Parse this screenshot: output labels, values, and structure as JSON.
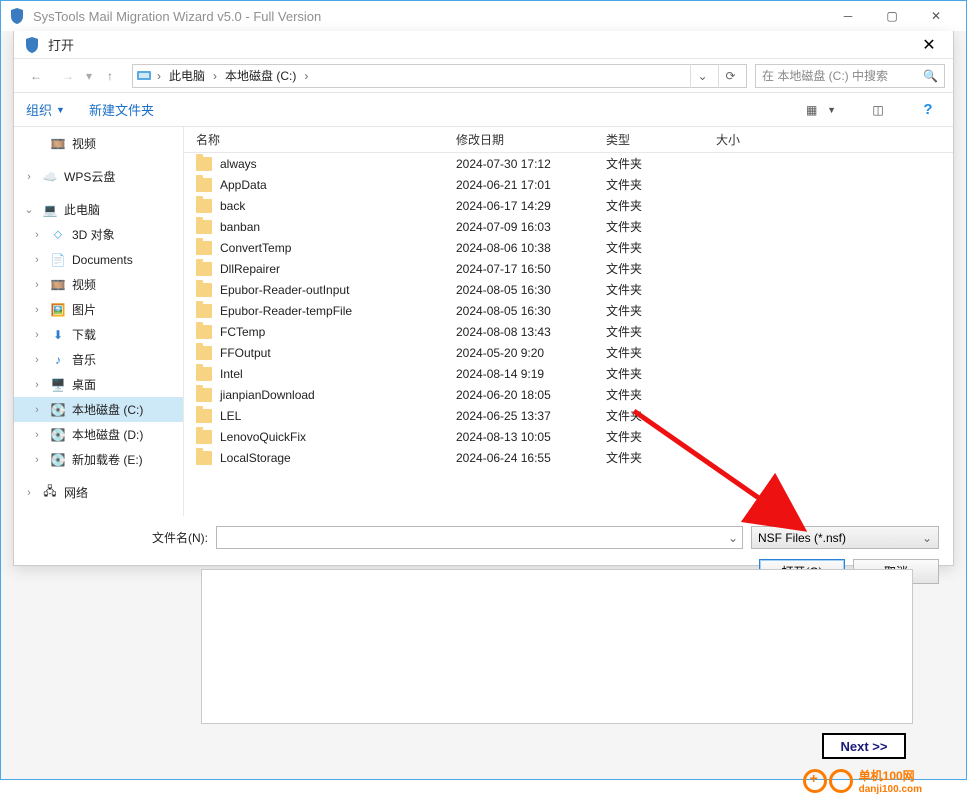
{
  "outerWindow": {
    "title": "SysTools Mail Migration Wizard v5.0 - Full Version"
  },
  "dialog": {
    "title": "打开",
    "breadcrumb": {
      "root": "此电脑",
      "drive": "本地磁盘 (C:)"
    },
    "searchPlaceholder": "在 本地磁盘 (C:) 中搜索",
    "toolbar": {
      "organize": "组织",
      "newFolder": "新建文件夹"
    },
    "columns": {
      "name": "名称",
      "date": "修改日期",
      "type": "类型",
      "size": "大小"
    },
    "sidebar": {
      "videos": "视频",
      "wps": "WPS云盘",
      "thisPC": "此电脑",
      "objects3d": "3D 对象",
      "documents": "Documents",
      "videos2": "视频",
      "pictures": "图片",
      "downloads": "下载",
      "music": "音乐",
      "desktop": "桌面",
      "driveC": "本地磁盘 (C:)",
      "driveD": "本地磁盘 (D:)",
      "driveE": "新加载卷 (E:)",
      "network": "网络"
    },
    "files": [
      {
        "name": "always",
        "date": "2024-07-30 17:12",
        "type": "文件夹"
      },
      {
        "name": "AppData",
        "date": "2024-06-21 17:01",
        "type": "文件夹"
      },
      {
        "name": "back",
        "date": "2024-06-17 14:29",
        "type": "文件夹"
      },
      {
        "name": "banban",
        "date": "2024-07-09 16:03",
        "type": "文件夹"
      },
      {
        "name": "ConvertTemp",
        "date": "2024-08-06 10:38",
        "type": "文件夹"
      },
      {
        "name": "DllRepairer",
        "date": "2024-07-17 16:50",
        "type": "文件夹"
      },
      {
        "name": "Epubor-Reader-outInput",
        "date": "2024-08-05 16:30",
        "type": "文件夹"
      },
      {
        "name": "Epubor-Reader-tempFile",
        "date": "2024-08-05 16:30",
        "type": "文件夹"
      },
      {
        "name": "FCTemp",
        "date": "2024-08-08 13:43",
        "type": "文件夹"
      },
      {
        "name": "FFOutput",
        "date": "2024-05-20 9:20",
        "type": "文件夹"
      },
      {
        "name": "Intel",
        "date": "2024-08-14 9:19",
        "type": "文件夹"
      },
      {
        "name": "jianpianDownload",
        "date": "2024-06-20 18:05",
        "type": "文件夹"
      },
      {
        "name": "LEL",
        "date": "2024-06-25 13:37",
        "type": "文件夹"
      },
      {
        "name": "LenovoQuickFix",
        "date": "2024-08-13 10:05",
        "type": "文件夹"
      },
      {
        "name": "LocalStorage",
        "date": "2024-06-24 16:55",
        "type": "文件夹"
      }
    ],
    "filenameLabel": "文件名(N):",
    "filter": "NSF Files (*.nsf)",
    "openBtn": "打开(O)",
    "cancelBtn": "取消"
  },
  "nextBtn": "Next >>",
  "watermark": {
    "line1": "单机100网",
    "line2": "danji100.com"
  }
}
